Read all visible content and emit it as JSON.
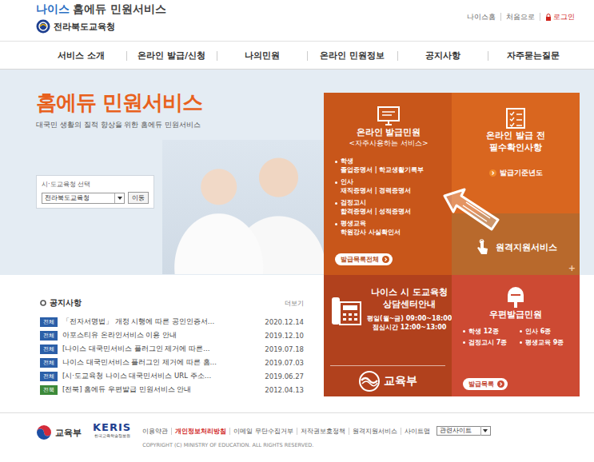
{
  "header": {
    "brand_main": "나이스",
    "brand_sub": "홈에듀 민원서비스",
    "org": "전라북도교육청",
    "links": [
      {
        "label": "나이스홈",
        "kind": "link"
      },
      {
        "label": "처음으로",
        "kind": "link"
      },
      {
        "label": "로그인",
        "kind": "login"
      }
    ]
  },
  "nav": [
    {
      "label": "서비스 소개"
    },
    {
      "label": "온라인 발급/신청"
    },
    {
      "label": "나의민원"
    },
    {
      "label": "온라인 민원정보"
    },
    {
      "label": "공지사항"
    },
    {
      "label": "자주묻는질문"
    }
  ],
  "hero": {
    "title": "홈에듀 민원서비스",
    "subtitle": "대국민 생활의 질적 향상을 위한 홈에듀 민원서비스",
    "region": {
      "label": "시·도교육청 선택",
      "value": "전라북도교육청",
      "button": "이동"
    }
  },
  "tiles": {
    "online_issue": {
      "title": "온라인 발급민원",
      "subtitle": "<자주사용하는 서비스>",
      "items": [
        {
          "category": "학생",
          "docs": "졸업증명서 | 학교생활기록부"
        },
        {
          "category": "인사",
          "docs": "재직증명서 | 경력증명서"
        },
        {
          "category": "검정고시",
          "docs": "합격증명서 | 성적증명서"
        },
        {
          "category": "평생교육",
          "docs": "학원강사 사실확인서"
        }
      ],
      "button": "발급목록전체"
    },
    "precheck": {
      "title": "온라인 발급 전",
      "subtitle": "필수확인사항",
      "link": "발급기준년도"
    },
    "remote": {
      "title": "원격지원서비스",
      "more": "+"
    },
    "callcenter": {
      "title": "나이스 시 도교육청",
      "subtitle": "상담센터안내",
      "hours": "평일(월~금) 09:00~18:00",
      "lunch": "점심시간 12:00~13:00",
      "ministry": "교육부"
    },
    "postal": {
      "title": "우편발급민원",
      "items": [
        {
          "label": "학생 12종"
        },
        {
          "label": "인사 6종"
        },
        {
          "label": "검정고시 7종"
        },
        {
          "label": "평생교육 9종"
        }
      ],
      "button": "발급목록"
    }
  },
  "notices": {
    "title": "공지사항",
    "more": "더보기",
    "items": [
      {
        "tag": "전체",
        "text": "「전자서명법」 개정 시행에 따른 공인인증서…",
        "date": "2020.12.14",
        "color": "#2b5fa8"
      },
      {
        "tag": "전체",
        "text": "아포스티유 온라인서비스 이용 안내",
        "date": "2019.12.10",
        "color": "#2b5fa8"
      },
      {
        "tag": "전체",
        "text": "[나이스 대국민서비스 플러그인 제거에 따른…",
        "date": "2019.07.18",
        "color": "#2b5fa8"
      },
      {
        "tag": "전체",
        "text": "나이스 대국민서비스 플러그인 제거에 따른 홈…",
        "date": "2019.07.03",
        "color": "#2b5fa8"
      },
      {
        "tag": "전체",
        "text": "[시·도교육청 나이스 대국민서비스 URL 주소…",
        "date": "2019.06.27",
        "color": "#2b5fa8"
      },
      {
        "tag": "전북",
        "text": "[전북] 홈에듀 우편발급 민원서비스 안내",
        "date": "2012.04.13",
        "color": "#3c8a3a"
      }
    ]
  },
  "footer": {
    "ministry": "교육부",
    "keris": "KERIS",
    "keris_sub": "한국교육학술정보원",
    "links": [
      {
        "label": "이용약관",
        "emphasized": false
      },
      {
        "label": "개인정보처리방침",
        "emphasized": true
      },
      {
        "label": "이메일 무단수집거부",
        "emphasized": false
      },
      {
        "label": "저작권보호정책",
        "emphasized": false
      },
      {
        "label": "원격지원서비스",
        "emphasized": false
      },
      {
        "label": "사이트맵",
        "emphasized": false
      }
    ],
    "related": "관련사이트",
    "copyright": "COPYRIGHT (C) MINISTRY OF EDUCATION. ALL RIGHTS RESERVED."
  }
}
